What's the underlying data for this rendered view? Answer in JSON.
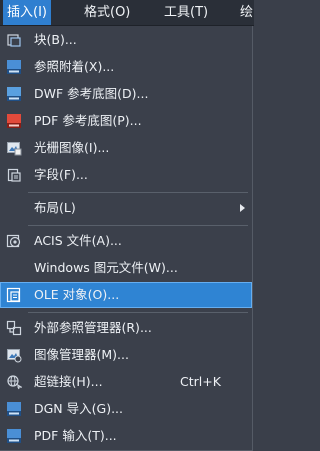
{
  "menubar": {
    "items": [
      "插入(I)",
      "格式(O)",
      "工具(T)",
      "绘"
    ]
  },
  "menu": {
    "items": [
      {
        "label": "块(B)...",
        "icon": "block-icon"
      },
      {
        "label": "参照附着(X)...",
        "icon": "dwg-reference-icon"
      },
      {
        "label": "DWF 参考底图(D)...",
        "icon": "dwf-underlay-icon"
      },
      {
        "label": "PDF 参考底图(P)...",
        "icon": "pdf-underlay-icon"
      },
      {
        "label": "光栅图像(I)...",
        "icon": "raster-image-icon"
      },
      {
        "label": "字段(F)...",
        "icon": "field-icon"
      },
      {
        "label": "布局(L)",
        "icon": ""
      },
      {
        "label": "ACIS 文件(A)...",
        "icon": "acis-file-icon"
      },
      {
        "label": "Windows 图元文件(W)...",
        "icon": ""
      },
      {
        "label": "OLE 对象(O)...",
        "icon": "ole-object-icon"
      },
      {
        "label": "外部参照管理器(R)...",
        "icon": "xref-manager-icon"
      },
      {
        "label": "图像管理器(M)...",
        "icon": "image-manager-icon"
      },
      {
        "label": "超链接(H)...",
        "icon": "hyperlink-icon",
        "shortcut": "Ctrl+K"
      },
      {
        "label": "DGN 导入(G)...",
        "icon": "dgn-import-icon"
      },
      {
        "label": "PDF 输入(T)...",
        "icon": "pdf-import-icon"
      }
    ]
  },
  "colors": {
    "menu_background": "#3b404b",
    "menubar_background": "#2a2f38",
    "highlight": "#2f84d3",
    "text": "#eef1f5"
  }
}
